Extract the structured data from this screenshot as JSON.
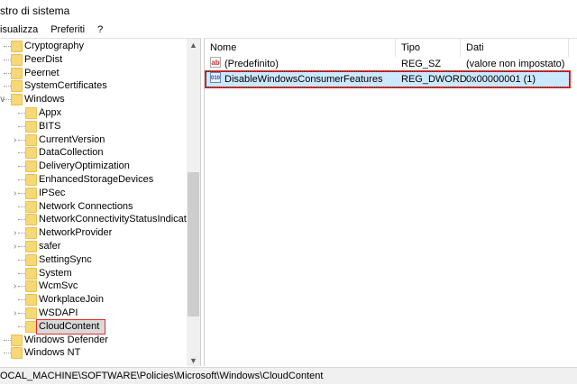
{
  "window": {
    "title": "stro di sistema"
  },
  "menu": [
    "isualizza",
    "Preferiti",
    "?"
  ],
  "tree": {
    "items": [
      {
        "label": "Cryptography",
        "level": 1,
        "exp": ""
      },
      {
        "label": "PeerDist",
        "level": 1,
        "exp": ""
      },
      {
        "label": "Peernet",
        "level": 1,
        "exp": ""
      },
      {
        "label": "SystemCertificates",
        "level": 1,
        "exp": ""
      },
      {
        "label": "Windows",
        "level": 1,
        "exp": "v"
      },
      {
        "label": "Appx",
        "level": 2,
        "exp": ""
      },
      {
        "label": "BITS",
        "level": 2,
        "exp": ""
      },
      {
        "label": "CurrentVersion",
        "level": 2,
        "exp": ">"
      },
      {
        "label": "DataCollection",
        "level": 2,
        "exp": ""
      },
      {
        "label": "DeliveryOptimization",
        "level": 2,
        "exp": ""
      },
      {
        "label": "EnhancedStorageDevices",
        "level": 2,
        "exp": ""
      },
      {
        "label": "IPSec",
        "level": 2,
        "exp": ">"
      },
      {
        "label": "Network Connections",
        "level": 2,
        "exp": ""
      },
      {
        "label": "NetworkConnectivityStatusIndicator",
        "level": 2,
        "exp": ""
      },
      {
        "label": "NetworkProvider",
        "level": 2,
        "exp": ">"
      },
      {
        "label": "safer",
        "level": 2,
        "exp": ">"
      },
      {
        "label": "SettingSync",
        "level": 2,
        "exp": ""
      },
      {
        "label": "System",
        "level": 2,
        "exp": ""
      },
      {
        "label": "WcmSvc",
        "level": 2,
        "exp": ">"
      },
      {
        "label": "WorkplaceJoin",
        "level": 2,
        "exp": ""
      },
      {
        "label": "WSDAPI",
        "level": 2,
        "exp": ">"
      },
      {
        "label": "CloudContent",
        "level": 2,
        "exp": "",
        "selected": true
      },
      {
        "label": "Windows Defender",
        "level": 1,
        "exp": ""
      },
      {
        "label": "Windows NT",
        "level": 1,
        "exp": ""
      }
    ]
  },
  "list": {
    "headers": [
      "Nome",
      "Tipo",
      "Dati"
    ],
    "rows": [
      {
        "icon": "ab",
        "name": "(Predefinito)",
        "type": "REG_SZ",
        "data": "(valore non impostato)"
      },
      {
        "icon": "binary",
        "name": "DisableWindowsConsumerFeatures",
        "type": "REG_DWORD",
        "data": "0x00000001 (1)",
        "selected": true
      }
    ]
  },
  "status": "OCAL_MACHINE\\SOFTWARE\\Policies\\Microsoft\\Windows\\CloudContent",
  "colors": {
    "highlight": "#e03030",
    "selection": "#cce8ff",
    "folder": "#f8d775"
  }
}
